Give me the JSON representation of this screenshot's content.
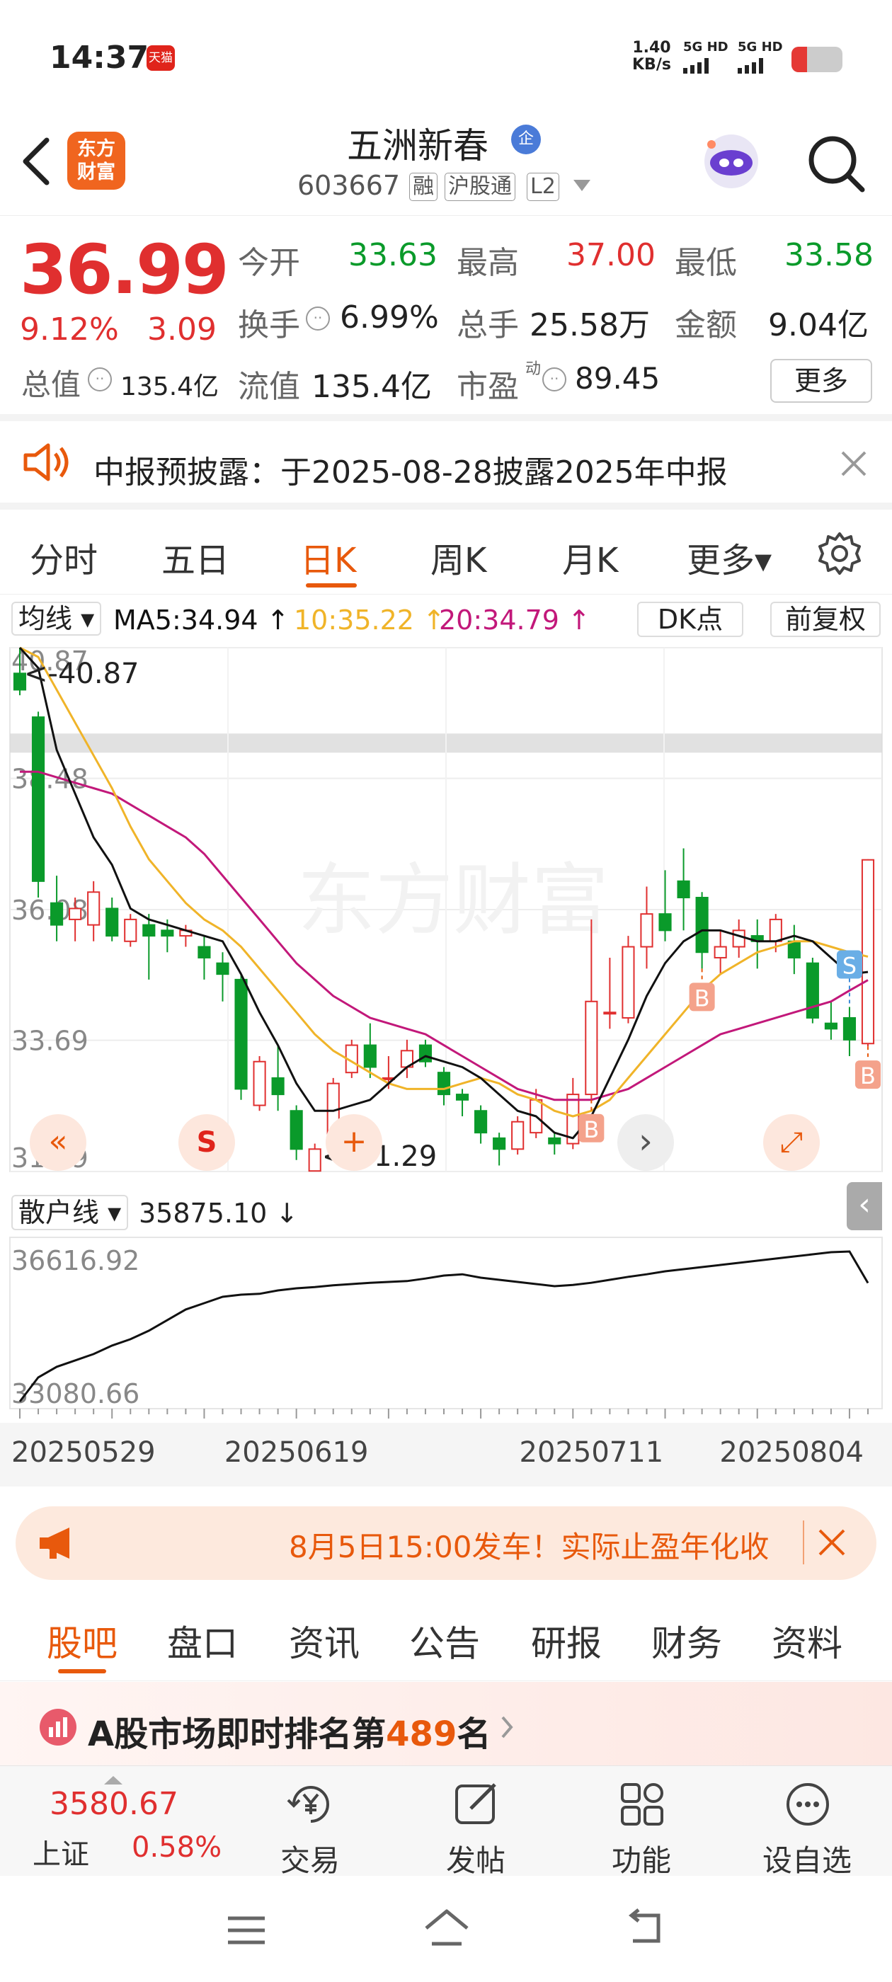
{
  "status_bar": {
    "time": "14:37",
    "app_badge": "天猫",
    "net_speed_value": "1.40",
    "net_speed_unit": "KB/s",
    "sig1": "5G HD",
    "sig2": "5G HD"
  },
  "header": {
    "logo_line1": "东方",
    "logo_line2": "财富",
    "stock_name": "五洲新春",
    "company_badge": "企",
    "stock_code": "603667",
    "tag_margin": "融",
    "tag_hk": "沪股通",
    "tag_level": "L2"
  },
  "quote": {
    "price": "36.99",
    "change_pct": "9.12%",
    "change_amt": "3.09",
    "open_label": "今开",
    "open_value": "33.63",
    "high_label": "最高",
    "high_value": "37.00",
    "low_label": "最低",
    "low_value": "33.58",
    "turnover_label": "换手",
    "turnover_value": "6.99%",
    "volume_label": "总手",
    "volume_value": "25.58万",
    "amount_label": "金额",
    "amount_value": "9.04亿",
    "mktcap_label": "总值",
    "mktcap_value": "135.4亿",
    "float_label": "流值",
    "float_value": "135.4亿",
    "pe_label": "市盈",
    "pe_sup": "动",
    "pe_value": "89.45",
    "more_button": "更多"
  },
  "notice": {
    "text": "中报预披露：于2025-08-28披露2025年中报"
  },
  "kline_tabs": [
    {
      "label": "分时",
      "active": false
    },
    {
      "label": "五日",
      "active": false
    },
    {
      "label": "日K",
      "active": true
    },
    {
      "label": "周K",
      "active": false
    },
    {
      "label": "月K",
      "active": false
    },
    {
      "label": "更多▾",
      "active": false
    }
  ],
  "ma_bar": {
    "selector": "均线",
    "ma5": "MA5:34.94 ↑",
    "ma10": "10:35.22 ↑",
    "ma20": "20:34.79 ↑",
    "dk_button": "DK点",
    "adjust_button": "前复权"
  },
  "chart_data": {
    "type": "candlestick",
    "ylim": [
      31.29,
      40.87
    ],
    "y_ticks": [
      "40.87",
      "38.48",
      "36.08",
      "33.69",
      "31.29"
    ],
    "high_marker": "<-40.87",
    "low_marker": "<-31.29",
    "watermark": "东方财富",
    "candles": [
      {
        "o": 40.4,
        "c": 40.1,
        "h": 40.87,
        "l": 40.0
      },
      {
        "o": 39.6,
        "c": 36.6,
        "h": 39.7,
        "l": 36.3
      },
      {
        "o": 36.2,
        "c": 35.8,
        "h": 36.7,
        "l": 35.5
      },
      {
        "o": 35.9,
        "c": 36.1,
        "h": 36.3,
        "l": 35.5
      },
      {
        "o": 35.8,
        "c": 36.4,
        "h": 36.6,
        "l": 35.5
      },
      {
        "o": 36.1,
        "c": 35.6,
        "h": 36.3,
        "l": 35.5
      },
      {
        "o": 35.5,
        "c": 35.9,
        "h": 36.0,
        "l": 35.4
      },
      {
        "o": 35.8,
        "c": 35.6,
        "h": 36.0,
        "l": 34.8
      },
      {
        "o": 35.7,
        "c": 35.6,
        "h": 35.9,
        "l": 35.3
      },
      {
        "o": 35.6,
        "c": 35.7,
        "h": 35.8,
        "l": 35.4
      },
      {
        "o": 35.4,
        "c": 35.2,
        "h": 35.6,
        "l": 34.8
      },
      {
        "o": 35.1,
        "c": 34.9,
        "h": 35.3,
        "l": 34.4
      },
      {
        "o": 34.8,
        "c": 32.8,
        "h": 34.9,
        "l": 32.6
      },
      {
        "o": 32.5,
        "c": 33.3,
        "h": 33.4,
        "l": 32.4
      },
      {
        "o": 33.0,
        "c": 32.7,
        "h": 33.6,
        "l": 32.4
      },
      {
        "o": 32.4,
        "c": 31.7,
        "h": 32.5,
        "l": 31.5
      },
      {
        "o": 31.3,
        "c": 31.7,
        "h": 31.8,
        "l": 31.29
      },
      {
        "o": 31.8,
        "c": 32.9,
        "h": 33.0,
        "l": 31.7
      },
      {
        "o": 33.1,
        "c": 33.6,
        "h": 33.7,
        "l": 33.0
      },
      {
        "o": 33.6,
        "c": 33.2,
        "h": 34.0,
        "l": 33.0
      },
      {
        "o": 33.0,
        "c": 33.0,
        "h": 33.4,
        "l": 32.8
      },
      {
        "o": 33.2,
        "c": 33.5,
        "h": 33.7,
        "l": 33.0
      },
      {
        "o": 33.6,
        "c": 33.3,
        "h": 33.7,
        "l": 33.2
      },
      {
        "o": 33.1,
        "c": 32.7,
        "h": 33.2,
        "l": 32.5
      },
      {
        "o": 32.7,
        "c": 32.6,
        "h": 32.8,
        "l": 32.3
      },
      {
        "o": 32.4,
        "c": 32.0,
        "h": 32.5,
        "l": 31.8
      },
      {
        "o": 31.9,
        "c": 31.7,
        "h": 32.0,
        "l": 31.4
      },
      {
        "o": 31.7,
        "c": 32.2,
        "h": 32.3,
        "l": 31.6
      },
      {
        "o": 32.0,
        "c": 32.6,
        "h": 32.8,
        "l": 31.9
      },
      {
        "o": 31.9,
        "c": 31.8,
        "h": 32.0,
        "l": 31.6
      },
      {
        "o": 31.8,
        "c": 32.7,
        "h": 33.0,
        "l": 31.7
      },
      {
        "o": 32.7,
        "c": 34.4,
        "h": 35.9,
        "l": 32.6
      },
      {
        "o": 34.2,
        "c": 34.2,
        "h": 35.2,
        "l": 33.9
      },
      {
        "o": 34.1,
        "c": 35.4,
        "h": 35.6,
        "l": 34.0
      },
      {
        "o": 35.4,
        "c": 36.0,
        "h": 36.5,
        "l": 35.0
      },
      {
        "o": 36.0,
        "c": 35.7,
        "h": 36.8,
        "l": 35.5
      },
      {
        "o": 36.6,
        "c": 36.3,
        "h": 37.2,
        "l": 35.7
      },
      {
        "o": 36.3,
        "c": 35.3,
        "h": 36.4,
        "l": 35.0
      },
      {
        "o": 35.2,
        "c": 35.4,
        "h": 35.7,
        "l": 34.9
      },
      {
        "o": 35.4,
        "c": 35.7,
        "h": 35.9,
        "l": 35.2
      },
      {
        "o": 35.6,
        "c": 35.5,
        "h": 35.9,
        "l": 35.0
      },
      {
        "o": 35.5,
        "c": 35.9,
        "h": 36.0,
        "l": 35.3
      },
      {
        "o": 35.5,
        "c": 35.2,
        "h": 35.8,
        "l": 34.9
      },
      {
        "o": 35.1,
        "c": 34.1,
        "h": 35.2,
        "l": 34.0
      },
      {
        "o": 34.0,
        "c": 33.9,
        "h": 34.4,
        "l": 33.7
      },
      {
        "o": 34.1,
        "c": 33.7,
        "h": 34.3,
        "l": 33.4
      },
      {
        "o": 33.63,
        "c": 36.99,
        "h": 37.0,
        "l": 33.58
      }
    ],
    "ma5": [
      40.87,
      40.5,
      39.0,
      38.2,
      37.4,
      36.9,
      36.1,
      35.9,
      35.8,
      35.7,
      35.6,
      35.5,
      34.9,
      34.2,
      33.6,
      32.9,
      32.4,
      32.4,
      32.5,
      32.6,
      32.9,
      33.2,
      33.4,
      33.3,
      33.2,
      33.0,
      32.7,
      32.4,
      32.3,
      32.0,
      31.9,
      32.3,
      33.0,
      33.7,
      34.5,
      35.1,
      35.5,
      35.7,
      35.7,
      35.6,
      35.5,
      35.5,
      35.6,
      35.5,
      35.2,
      34.9,
      34.94
    ],
    "ma10": [
      40.87,
      40.7,
      40.1,
      39.5,
      38.9,
      38.3,
      37.6,
      37.0,
      36.6,
      36.2,
      35.9,
      35.7,
      35.4,
      35.0,
      34.6,
      34.2,
      33.8,
      33.5,
      33.3,
      33.1,
      32.9,
      32.8,
      32.8,
      32.8,
      32.9,
      33.0,
      32.9,
      32.7,
      32.6,
      32.4,
      32.3,
      32.4,
      32.6,
      33.0,
      33.4,
      33.8,
      34.2,
      34.6,
      34.9,
      35.1,
      35.3,
      35.4,
      35.5,
      35.5,
      35.4,
      35.3,
      35.22
    ],
    "ma20": [
      38.6,
      38.6,
      38.5,
      38.4,
      38.3,
      38.2,
      38.0,
      37.8,
      37.6,
      37.4,
      37.1,
      36.7,
      36.3,
      35.9,
      35.5,
      35.1,
      34.8,
      34.5,
      34.3,
      34.1,
      34.0,
      33.9,
      33.8,
      33.6,
      33.4,
      33.2,
      33.0,
      32.8,
      32.7,
      32.6,
      32.6,
      32.6,
      32.7,
      32.8,
      33.0,
      33.2,
      33.4,
      33.6,
      33.8,
      33.9,
      34.0,
      34.1,
      34.2,
      34.3,
      34.4,
      34.6,
      34.79
    ],
    "signals": [
      {
        "type": "B",
        "index": 31
      },
      {
        "type": "B",
        "index": 37
      },
      {
        "type": "S",
        "index": 45
      },
      {
        "type": "B",
        "index": 46
      }
    ],
    "x_ticks": [
      "20250529",
      "20250619",
      "20250711",
      "20250804"
    ],
    "retail_indicator": {
      "label": "散户线",
      "value": "35875.10 ↓",
      "ylim": [
        33080.66,
        36616.92
      ],
      "y_ticks": [
        "36616.92",
        "33080.66"
      ],
      "values": [
        33080.66,
        33650,
        33900,
        34050,
        34200,
        34400,
        34550,
        34750,
        35000,
        35250,
        35400,
        35550,
        35600,
        35620,
        35700,
        35750,
        35780,
        35820,
        35850,
        35880,
        35900,
        35920,
        35980,
        36050,
        36080,
        36000,
        35950,
        35900,
        35850,
        35800,
        35830,
        35880,
        35950,
        36020,
        36080,
        36150,
        36200,
        36250,
        36300,
        36350,
        36400,
        36450,
        36500,
        36550,
        36600,
        36616.92,
        35875.1
      ]
    }
  },
  "chart_controls": {
    "rewind": "«",
    "s_button": "S",
    "plus_button": "+",
    "next_button": "›",
    "expand_button": "⤢",
    "collapse_button": "‹"
  },
  "promo": {
    "text": "8月5日15:00发车！实际止盈年化收"
  },
  "sub_tabs": [
    {
      "label": "股吧",
      "active": true
    },
    {
      "label": "盘口",
      "active": false
    },
    {
      "label": "资讯",
      "active": false
    },
    {
      "label": "公告",
      "active": false
    },
    {
      "label": "研报",
      "active": false
    },
    {
      "label": "财务",
      "active": false
    },
    {
      "label": "资料",
      "active": false
    }
  ],
  "rank": {
    "prefix": "A股市场即时排名第",
    "number": "489",
    "suffix": "名"
  },
  "bottom_nav": {
    "index_value": "3580.67",
    "index_name": "上证",
    "index_change": "0.58%",
    "trade": "交易",
    "post": "发帖",
    "functions": "功能",
    "watchlist": "设自选"
  },
  "colors": {
    "up": "#e02f2f",
    "down": "#0a9a2a",
    "accent": "#e8590c",
    "ma5": "#111111",
    "ma10": "#f0b429",
    "ma20": "#c2187a"
  }
}
